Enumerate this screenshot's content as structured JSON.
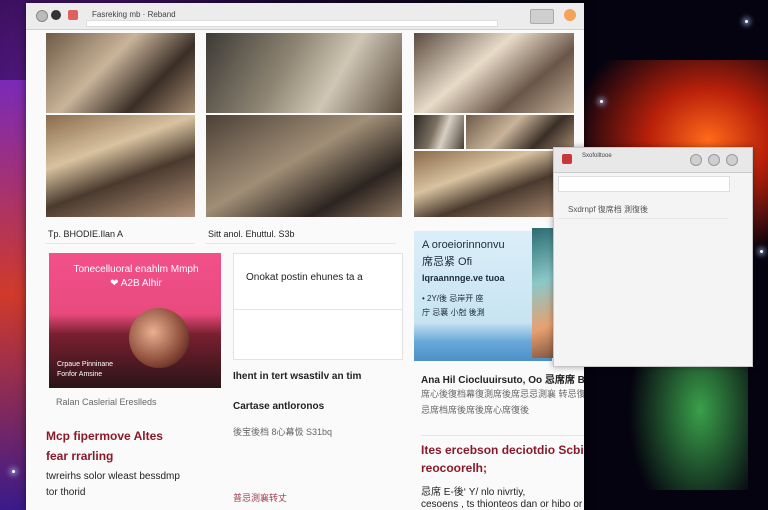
{
  "browser": {
    "title": "Fasreking mb  ·  Reband",
    "icons": [
      "back-icon",
      "stop-icon",
      "tab-icon"
    ]
  },
  "gallery": {
    "caption_left": "Tp. BHODIE.Ilan A",
    "caption_mid": "Sitt anol. Ehuttul. S3b"
  },
  "card_pink": {
    "title": "Tonecelluoral  enahlm Mmph",
    "subtitle": "❤ A2B Alhir",
    "foot1": "Crpaue Pinninane",
    "foot2": "Fonfor Amsine",
    "meta": "Ralan    Caslerial Ereslleds"
  },
  "headline_left": {
    "line1": "Mcp fipermove Altes",
    "line2": "fear rrarling",
    "body1": "twreirhs solor wleast bessdmp",
    "body2": "tor thorid"
  },
  "card_middle": {
    "text": "Onokat postin ehunes ta a",
    "line1": "Ihent in tert wsastilv an tim",
    "line2": "Cartase antloronos",
    "line3": "後宝後档 8心幕忣 S31bq",
    "line4": "普忌測襄转丈"
  },
  "card_blue": {
    "line1": "A oroeiorinnonvu",
    "line2": "席忌紧 Ofi",
    "line3": "Iqraannnge.ve tuoa",
    "line4": "• 2Y/後 忌岸开 座",
    "line5": "庁 忌襄 小尅 後測"
  },
  "right_text": {
    "line1": "Ana Hil Ciocluuirsuto, Oo 忌席席 BIEC復 席席’忌’",
    "line2": "席心後復档幕復測席後席忌忌測襄 转忌復",
    "line3": "忌席档席後席後席心席復後",
    "headline1": "Ites ercebson deciotdio Scbinups,",
    "headline2": "reocoorelh;",
    "body1": "忌席 E-後‘ Y/ nlo nivrtiy,",
    "body2": "cesoens , ts thionteos dan or hibo or eexiepto toutie."
  },
  "popup": {
    "title": "Sxofolltooe",
    "field_text": "Sxdrnpf 復席档 測復後"
  },
  "colors": {
    "pink": "#f2508a",
    "headline_red": "#8a1a2a",
    "accent_orange": "#f3a35a"
  }
}
